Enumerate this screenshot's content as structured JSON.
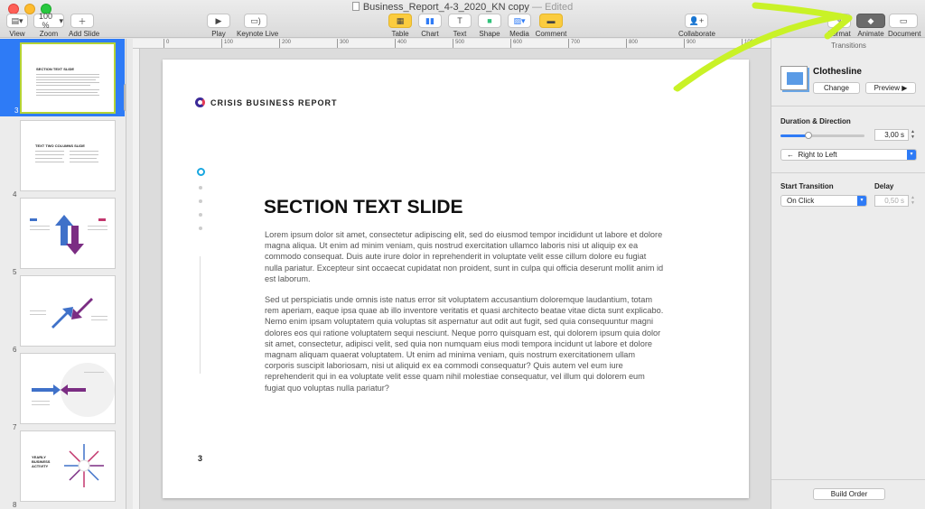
{
  "window": {
    "doc_name": "Business_Report_4-3_2020_KN copy",
    "doc_status": "— Edited"
  },
  "toolbar": {
    "view": "View",
    "zoom_value": "100 %",
    "zoom": "Zoom",
    "add_slide": "Add Slide",
    "play": "Play",
    "keynote_live": "Keynote Live",
    "table": "Table",
    "chart": "Chart",
    "text": "Text",
    "shape": "Shape",
    "media": "Media",
    "comment": "Comment",
    "collaborate": "Collaborate",
    "format": "Format",
    "animate": "Animate",
    "document": "Document"
  },
  "navigator": {
    "slides": [
      {
        "number": "3",
        "title": "SECTION TEXT SLIDE"
      },
      {
        "number": "4",
        "title": "TEXT TWO COLUMNS SLIDE"
      },
      {
        "number": "5",
        "title": ""
      },
      {
        "number": "6",
        "title": ""
      },
      {
        "number": "7",
        "title": ""
      },
      {
        "number": "8",
        "title": "YEARLY BUSINESS ACTIVITY"
      }
    ]
  },
  "ruler": {
    "ticks": [
      "0",
      "100",
      "200",
      "300",
      "400",
      "500",
      "600",
      "700",
      "800",
      "900",
      "1000"
    ]
  },
  "slide": {
    "brand": "CRISIS BUSINESS REPORT",
    "title": "SECTION TEXT SLIDE",
    "paragraph1": "Lorem ipsum dolor sit amet, consectetur adipiscing elit, sed do eiusmod tempor incididunt ut labore et dolore magna aliqua. Ut enim ad minim veniam, quis nostrud exercitation ullamco laboris nisi ut aliquip ex ea commodo consequat. Duis aute irure dolor in reprehenderit in voluptate velit esse cillum dolore eu fugiat nulla pariatur. Excepteur sint occaecat cupidatat non proident, sunt in culpa qui officia deserunt mollit anim id est laborum.",
    "paragraph2": "Sed ut perspiciatis unde omnis iste natus error sit voluptatem accusantium doloremque laudantium, totam rem aperiam, eaque ipsa quae ab illo inventore veritatis et quasi architecto beatae vitae dicta sunt explicabo. Nemo enim ipsam voluptatem quia voluptas sit aspernatur aut odit aut fugit, sed quia consequuntur magni dolores eos qui ratione voluptatem sequi nesciunt. Neque porro quisquam est, qui dolorem ipsum quia dolor sit amet, consectetur, adipisci velit, sed quia non numquam eius modi tempora incidunt ut labore et dolore magnam aliquam quaerat voluptatem. Ut enim ad minima veniam, quis nostrum exercitationem ullam corporis suscipit laboriosam, nisi ut aliquid ex ea commodi consequatur? Quis autem vel eum iure reprehenderit qui in ea voluptate velit esse quam nihil molestiae consequatur, vel illum qui dolorem eum fugiat quo voluptas nulla pariatur?",
    "page_number": "3"
  },
  "inspector": {
    "tab_label": "Transitions",
    "transition_name": "Clothesline",
    "change": "Change",
    "preview": "Preview",
    "duration_label": "Duration & Direction",
    "duration_value": "3,00 s",
    "duration_fraction": 0.33,
    "direction": "Right to Left",
    "start_label": "Start Transition",
    "start_value": "On Click",
    "delay_label": "Delay",
    "delay_value": "0,50 s",
    "build_order": "Build Order"
  },
  "colors": {
    "accent_blue": "#2e7bf6",
    "annotation": "#c9f227",
    "brand_purple": "#3b2a98",
    "brand_red": "#e43b57",
    "dot_active": "#19a7e0"
  }
}
